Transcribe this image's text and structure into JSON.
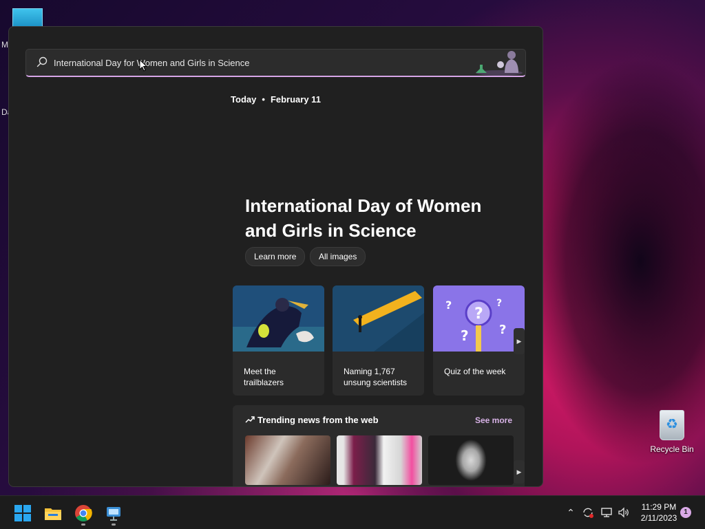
{
  "search": {
    "query": "International Day for Women and Girls in Science",
    "placeholder": ""
  },
  "header": {
    "today_label": "Today",
    "date": "February 11"
  },
  "hero": {
    "title": "International Day of Women and Girls in Science",
    "buttons": [
      "Learn more",
      "All images"
    ]
  },
  "cards": [
    {
      "caption": "Meet the trailblazers",
      "icon": "scuba-diver-image"
    },
    {
      "caption": "Naming 1,767 unsung scientists",
      "icon": "spotlight-image"
    },
    {
      "caption": "Quiz of the week",
      "icon": "question-magnifier-image"
    }
  ],
  "trending": {
    "title": "Trending news from the web",
    "see_more": "See more"
  },
  "desktop": {
    "recycle_bin": "Recycle Bin",
    "edge_letters": [
      "M",
      "Da"
    ]
  },
  "taskbar": {
    "time": "11:29 PM",
    "date": "2/11/2023",
    "notification_count": "1",
    "pinned": [
      "start-icon",
      "file-explorer-icon",
      "chrome-icon",
      "app-icon"
    ]
  },
  "colors": {
    "accent": "#d7a6e8",
    "panel_bg": "#202020",
    "card_bg": "#2b2b2b"
  }
}
